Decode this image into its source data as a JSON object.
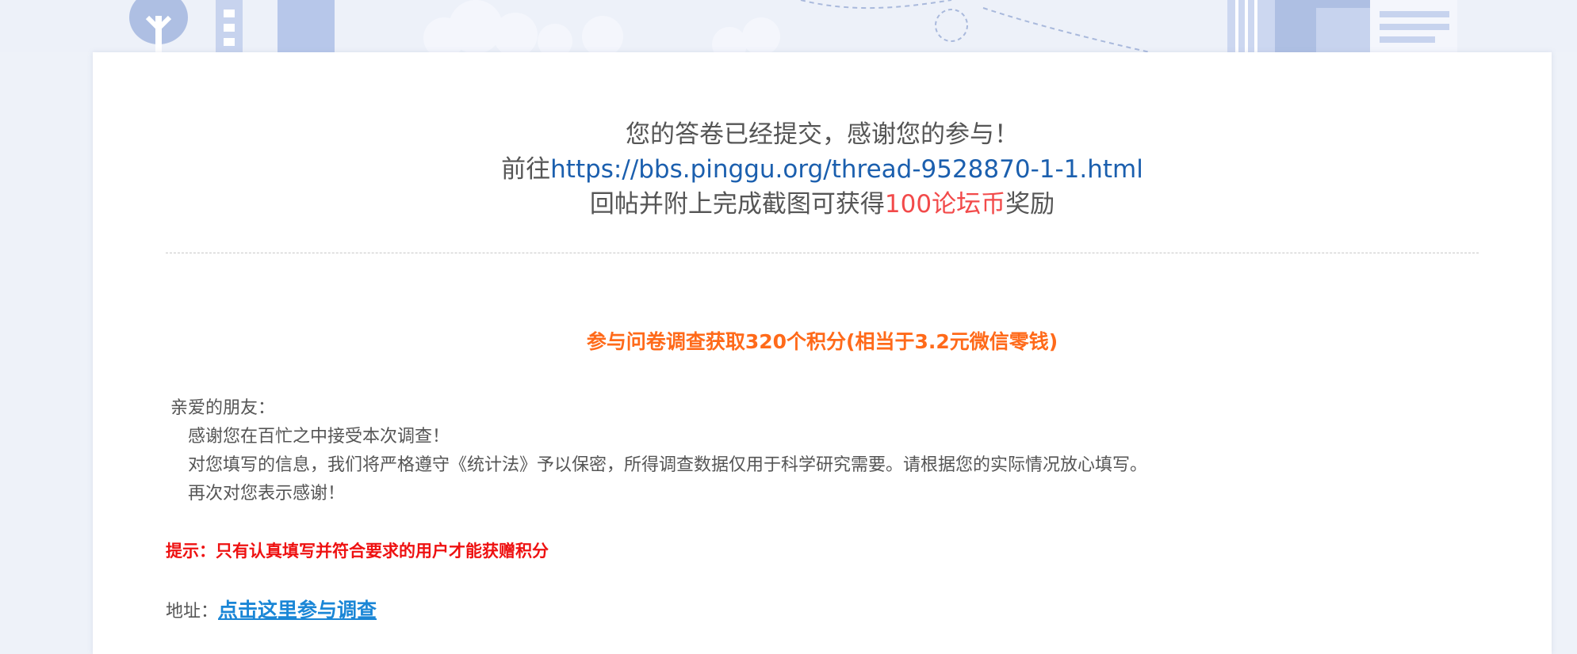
{
  "banner": {
    "accent_colors": [
      "#aebfe3",
      "#c7d3ee",
      "#ffffff"
    ]
  },
  "confirmation": {
    "line1": "您的答卷已经提交，感谢您的参与！",
    "line2_prefix": "前往",
    "line2_link": "https://bbs.pinggu.org/thread-9528870-1-1.html",
    "line3_prefix": "回帖并附上完成截图可获得",
    "line3_reward": "100论坛币",
    "line3_suffix": "奖励"
  },
  "survey": {
    "title": "参与问卷调查获取320个积分(相当于3.2元微信零钱)",
    "greeting": "亲爱的朋友：",
    "paragraphs": [
      "感谢您在百忙之中接受本次调查！",
      "对您填写的信息，我们将严格遵守《统计法》予以保密，所得调查数据仅用于科学研究需要。请根据您的实际情况放心填写。",
      "再次对您表示感谢！"
    ],
    "hint": "提示：只有认真填写并符合要求的用户才能获赠积分",
    "address_label": "地址：",
    "address_link": "点击这里参与调查"
  },
  "colors": {
    "link": "#1b5fae",
    "reward": "#f24a4a",
    "title": "#ff6a1a",
    "hint": "#ee1111",
    "address_link": "#1a86d6"
  }
}
